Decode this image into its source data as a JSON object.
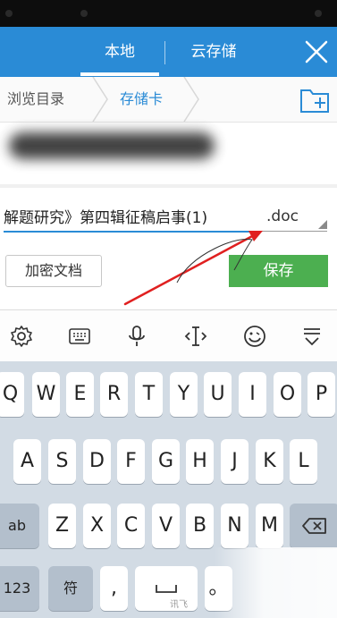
{
  "header": {
    "tabs": [
      {
        "label": "本地",
        "active": true
      },
      {
        "label": "云存储",
        "active": false
      }
    ],
    "close_icon": "close-icon"
  },
  "breadcrumb": {
    "items": [
      "浏览目录",
      "存储卡"
    ],
    "new_folder_icon": "new-folder-icon"
  },
  "file": {
    "name": "解题研究》第四辑征稿启事(1)",
    "extension": ".doc"
  },
  "actions": {
    "encrypt_label": "加密文档",
    "save_label": "保存"
  },
  "keyboard": {
    "toolbar_icons": [
      "gear-icon",
      "keyboard-icon",
      "microphone-icon",
      "cursor-icon",
      "emoji-icon",
      "hide-keyboard-icon"
    ],
    "row1": [
      "Q",
      "W",
      "E",
      "R",
      "T",
      "Y",
      "U",
      "I",
      "O",
      "P"
    ],
    "row2": [
      "A",
      "S",
      "D",
      "F",
      "G",
      "H",
      "J",
      "K",
      "L"
    ],
    "row3": [
      "ab",
      "Z",
      "X",
      "C",
      "V",
      "B",
      "N",
      "M"
    ],
    "row4": [
      "123",
      "符",
      ",",
      "讯飞",
      "。"
    ]
  },
  "colors": {
    "header": "#2a8bd6",
    "save_button": "#4caf50",
    "keyboard_background": "#d2dbe4",
    "annotation_arrow": "#e02020"
  }
}
